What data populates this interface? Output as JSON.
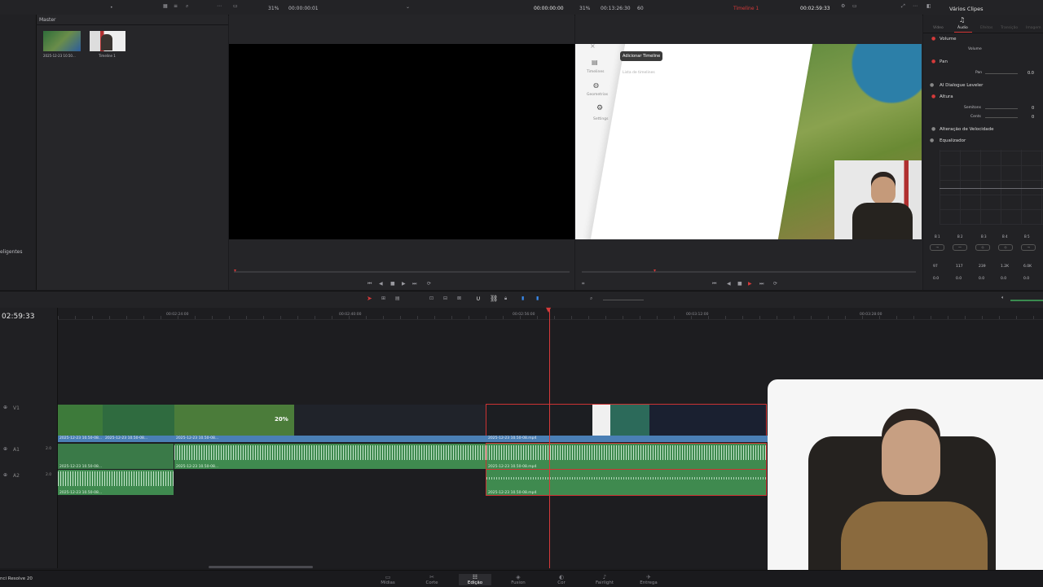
{
  "mediaPool": {
    "bin": "Master",
    "items": [
      {
        "name": "2025-12-23 10.50..."
      },
      {
        "name": "Timeline 1"
      }
    ],
    "side_label": "eligentes"
  },
  "sourceViewer": {
    "zoom": "31%",
    "timecode": "00:00:00:01",
    "timecode2": "00:00:00:00"
  },
  "timelineViewer": {
    "zoom": "31%",
    "duration": "00:13:26:30",
    "fps": "60",
    "timeline_name": "Timeline 1",
    "timecode": "00:02:59:33"
  },
  "preview": {
    "add_button": "Adicionar Timeline",
    "list_label": "Lista de timelines",
    "nav": [
      {
        "label": "Timelines"
      },
      {
        "label": "Geometrias"
      },
      {
        "label": "Settings"
      }
    ]
  },
  "inspector": {
    "title": "Vários Clipes",
    "tabs": [
      "Vídeo",
      "Áudio",
      "Efeitos",
      "Transição",
      "Imagem"
    ],
    "active_tab": "Áudio",
    "volume_section": "Volume",
    "volume_label": "Volume",
    "pan_section": "Pan",
    "pan_label": "Pan",
    "pan_value": "0.0",
    "dialogue": "AI Dialogue Leveler",
    "altura_section": "Altura",
    "semitons_label": "Semitons",
    "semitons_value": "0",
    "cents_label": "Cents",
    "cents_value": "0",
    "speed_section": "Alteração de Velocidade",
    "eq_section": "Equalizador",
    "bands": [
      "B 1",
      "B 2",
      "B 3",
      "B 4",
      "B 5"
    ],
    "freqs": [
      "97",
      "117",
      "239",
      "1.2K",
      "6.0K"
    ],
    "gains": [
      "0.0",
      "0.0",
      "0.0",
      "0.0",
      "0.0"
    ]
  },
  "timeline": {
    "current_tc": "02:59:33",
    "ruler": [
      "00:02:24:00",
      "00:02:40:00",
      "00:02:56:00",
      "00:03:12:00",
      "00:03:28:00"
    ],
    "video_clip_label": "2025-12-23 10.50-08...",
    "clip_full": "2025-12-23 10.50-08.mp4",
    "clip_short": "2025-12-23 10.50-08...",
    "percent_overlay": "20%",
    "track_v1": "V1",
    "track_a1": "A1",
    "track_a2": "A2",
    "level": "2.0"
  },
  "nav": {
    "app": "nci Resolve 20",
    "pages": [
      "Mídias",
      "Corte",
      "Edição",
      "Fusion",
      "Cor",
      "Fairlight",
      "Entrega"
    ],
    "active": "Edição"
  },
  "colors": {
    "accent": "#d63a3a",
    "video_clip": "#4a7fb5",
    "audio_clip": "#3f8a4f"
  }
}
